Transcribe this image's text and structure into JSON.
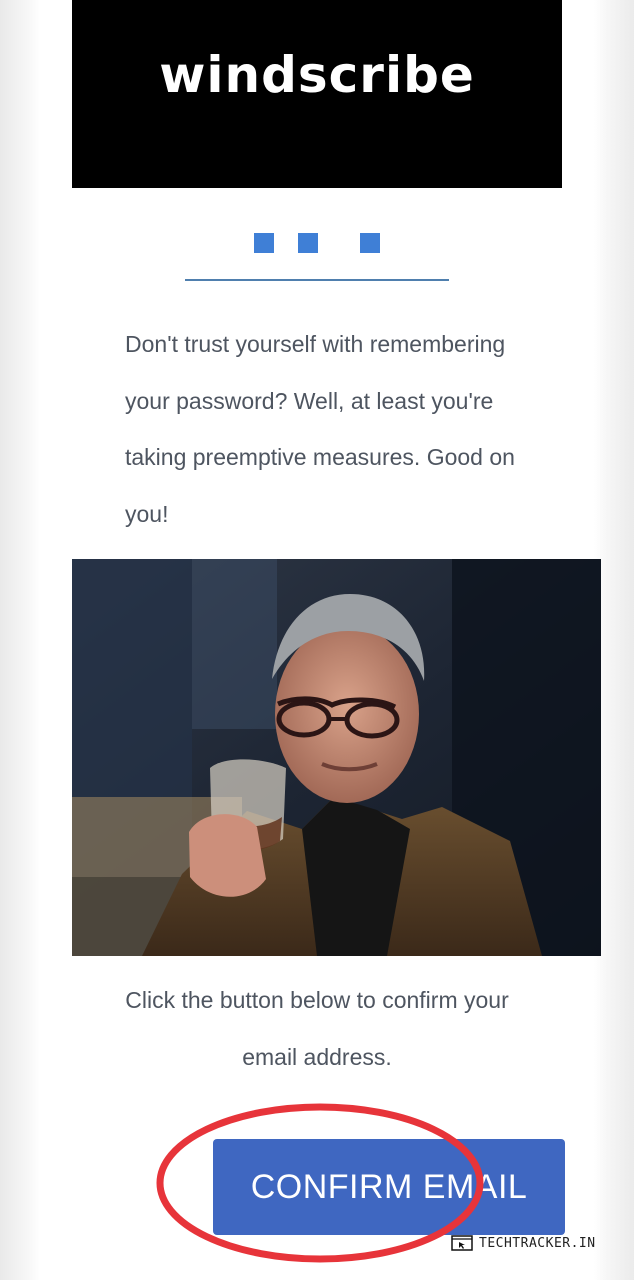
{
  "brand": {
    "logo_text": "windscribe",
    "accent_color": "#3f67c1",
    "dot_color": "#3f7fd6",
    "header_bg": "#000000"
  },
  "content": {
    "intro_text": "Don't trust yourself with remembering your password? Well, at least you're taking preemptive measures. Good on you!",
    "gif_description": "",
    "confirm_text": "Click the button below to confirm your email address."
  },
  "actions": {
    "confirm_button_label": "CONFIRM EMAIL"
  },
  "watermark": {
    "text": "TECHTRACKER.IN",
    "icon": "browser-cursor-icon"
  }
}
